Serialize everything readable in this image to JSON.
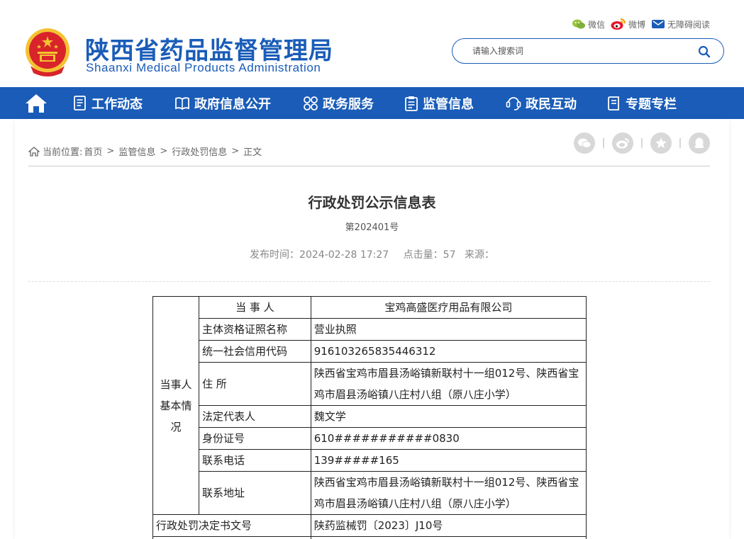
{
  "header": {
    "title_cn": "陕西省药品监督管理局",
    "title_en": "Shaanxi Medical Products Administration",
    "links": [
      {
        "label": "微信",
        "icon": "wechat-icon"
      },
      {
        "label": "微博",
        "icon": "weibo-icon"
      },
      {
        "label": "无障碍阅读",
        "icon": "accessibility-icon"
      }
    ],
    "search": {
      "placeholder": "请输入搜索词",
      "value": ""
    }
  },
  "nav": {
    "items": [
      {
        "label": "工作动态",
        "icon": "document-list-icon"
      },
      {
        "label": "政府信息公开",
        "icon": "book-icon"
      },
      {
        "label": "政务服务",
        "icon": "grid-icon"
      },
      {
        "label": "监管信息",
        "icon": "clipboard-icon"
      },
      {
        "label": "政民互动",
        "icon": "interaction-icon"
      },
      {
        "label": "专题专栏",
        "icon": "notebook-icon"
      }
    ]
  },
  "breadcrumb": {
    "prefix": "当前位置:",
    "items": [
      "首页",
      "监管信息",
      "行政处罚信息",
      "正文"
    ]
  },
  "article": {
    "title": "行政处罚公示信息表",
    "number": "第202401号",
    "publish_label": "发布时间：",
    "publish_time": "2024-02-28 17:27",
    "clicks_label": "点击量：",
    "clicks": "57",
    "source_label": "来源："
  },
  "table": {
    "group_label": "当事人基本情况",
    "party_label": "当 事 人",
    "party_value": "宝鸡高盛医疗用品有限公司",
    "rows": [
      {
        "label": "主体资格证照名称",
        "value": "营业执照"
      },
      {
        "label": "统一社会信用代码",
        "value": "916103265835446312"
      },
      {
        "label": "住 所",
        "value": "陕西省宝鸡市眉县汤峪镇新联村十一组012号、陕西省宝鸡市眉县汤峪镇八庄村八组（原八庄小学）"
      },
      {
        "label": "法定代表人",
        "value": "魏文学"
      },
      {
        "label": "身份证号",
        "value": "610###########0830"
      },
      {
        "label": "联系电话",
        "value": "139#####165"
      },
      {
        "label": "联系地址",
        "value": "陕西省宝鸡市眉县汤峪镇新联村十一组012号、陕西省宝鸡市眉县汤峪镇八庄村八组（原八庄小学）"
      }
    ],
    "decision_label": "行政处罚决定书文号",
    "decision_value": "陕药监械罚〔2023〕J10号"
  },
  "colors": {
    "brand_blue": "#1a5cb8",
    "emblem_red": "#d8242a",
    "emblem_gold": "#f4c232"
  }
}
